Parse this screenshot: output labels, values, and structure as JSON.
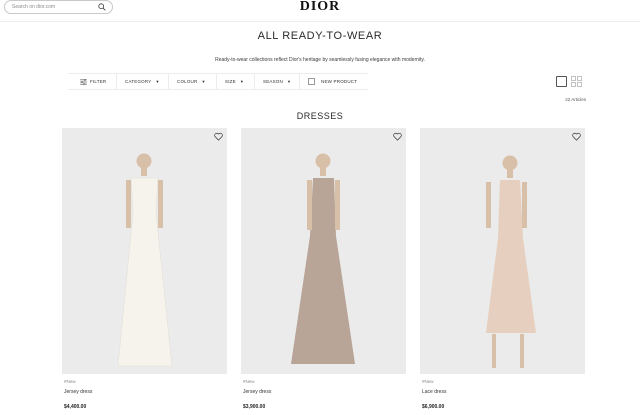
{
  "header": {
    "search_placeholder": "Search on dior.com",
    "logo": "DIOR"
  },
  "page": {
    "title": "ALL READY-TO-WEAR",
    "subtitle": "Ready-to-wear collections reflect Dior's heritage by seamlessly fusing elegance with modernity."
  },
  "filters": {
    "filter": "FILTER",
    "category": "CATEGORY",
    "colour": "COLOUR",
    "size": "SIZE",
    "season": "SEASON",
    "new_product": "NEW PRODUCT"
  },
  "article_count": "22 Articles",
  "section_title": "DRESSES",
  "products": [
    {
      "badge": "#New",
      "name": "Jersey dress",
      "price": "$4,400.00",
      "dress_color": "#f6f3ec"
    },
    {
      "badge": "#New",
      "name": "Jersey dress",
      "price": "$3,900.00",
      "dress_color": "#b8a597"
    },
    {
      "badge": "#New",
      "name": "Lace dress",
      "price": "$6,900.00",
      "dress_color": "#e6cfbe"
    }
  ],
  "colors": {
    "card_background": "#ebebeb",
    "text": "#33383c"
  }
}
